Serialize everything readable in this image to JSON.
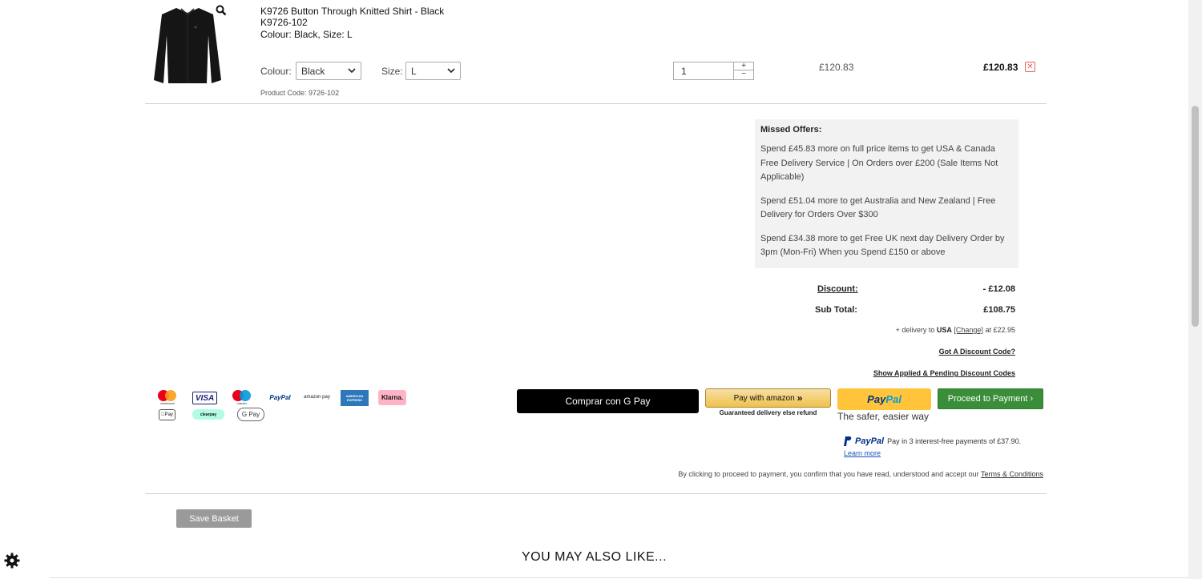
{
  "product": {
    "name": "K9726 Button Through Knitted Shirt - Black",
    "sku": "K9726-102",
    "variant": "Colour: Black, Size: L",
    "colour_label": "Colour:",
    "colour_value": "Black",
    "size_label": "Size:",
    "size_value": "L",
    "product_code": "Product Code: 9726-102",
    "quantity": "1",
    "qty_plus": "+",
    "qty_minus": "−",
    "unit_price": "£120.83",
    "line_total": "£120.83",
    "remove_glyph": "✕"
  },
  "missed_offers": {
    "title": "Missed Offers:",
    "items": [
      "Spend £45.83 more on full price items to get USA & Canada Free Delivery Service | On Orders over £200 (Sale Items Not Applicable)",
      "Spend £51.04 more to get Australia and New Zealand | Free Delivery for Orders Over $300",
      "Spend £34.38 more to get Free UK next day Delivery Order by 3pm (Mon-Fri) When you Spend £150 or above"
    ]
  },
  "summary": {
    "discount_label": "Discount:",
    "discount_value": "- £12.08",
    "subtotal_label": "Sub Total:",
    "subtotal_value": "£108.75",
    "delivery_prefix": "+ delivery to",
    "delivery_country": "USA",
    "delivery_change": "[Change]",
    "delivery_suffix": "at £22.95",
    "discount_code_link": "Got A Discount Code?",
    "applied_codes_link": "Show Applied & Pending Discount Codes"
  },
  "payment_logos": [
    "mastercard",
    "VISA",
    "maestro",
    "PayPal",
    "amazon pay",
    "AMERICAN EXPRESS",
    "Klarna.",
    "Pay",
    "clearpay",
    "G Pay"
  ],
  "buttons": {
    "gpay": "Comprar con G Pay",
    "amazon": "Pay with amazon",
    "amazon_sub": "Guaranteed delivery else refund",
    "paypal_pay": "Pay",
    "paypal_pal": "Pal",
    "paypal_tagline": "The safer, easier way",
    "proceed": "Proceed to Payment ›",
    "save_basket": "Save Basket"
  },
  "paypal_credit": {
    "brand": "PayPal",
    "text": "Pay in 3 interest-free payments of £37.90.",
    "learn_more": "Learn more"
  },
  "terms": {
    "text": "By clicking to proceed to payment, you confirm that you have read, understood and accept our",
    "link": "Terms & Conditions"
  },
  "you_may_also_like": "YOU MAY ALSO LIKE...",
  "colors": {
    "proceed_green": "#3a8e3a",
    "paypal_yellow": "#ffc439",
    "offers_bg": "#f2f2f2",
    "remove_red": "#e06060"
  }
}
